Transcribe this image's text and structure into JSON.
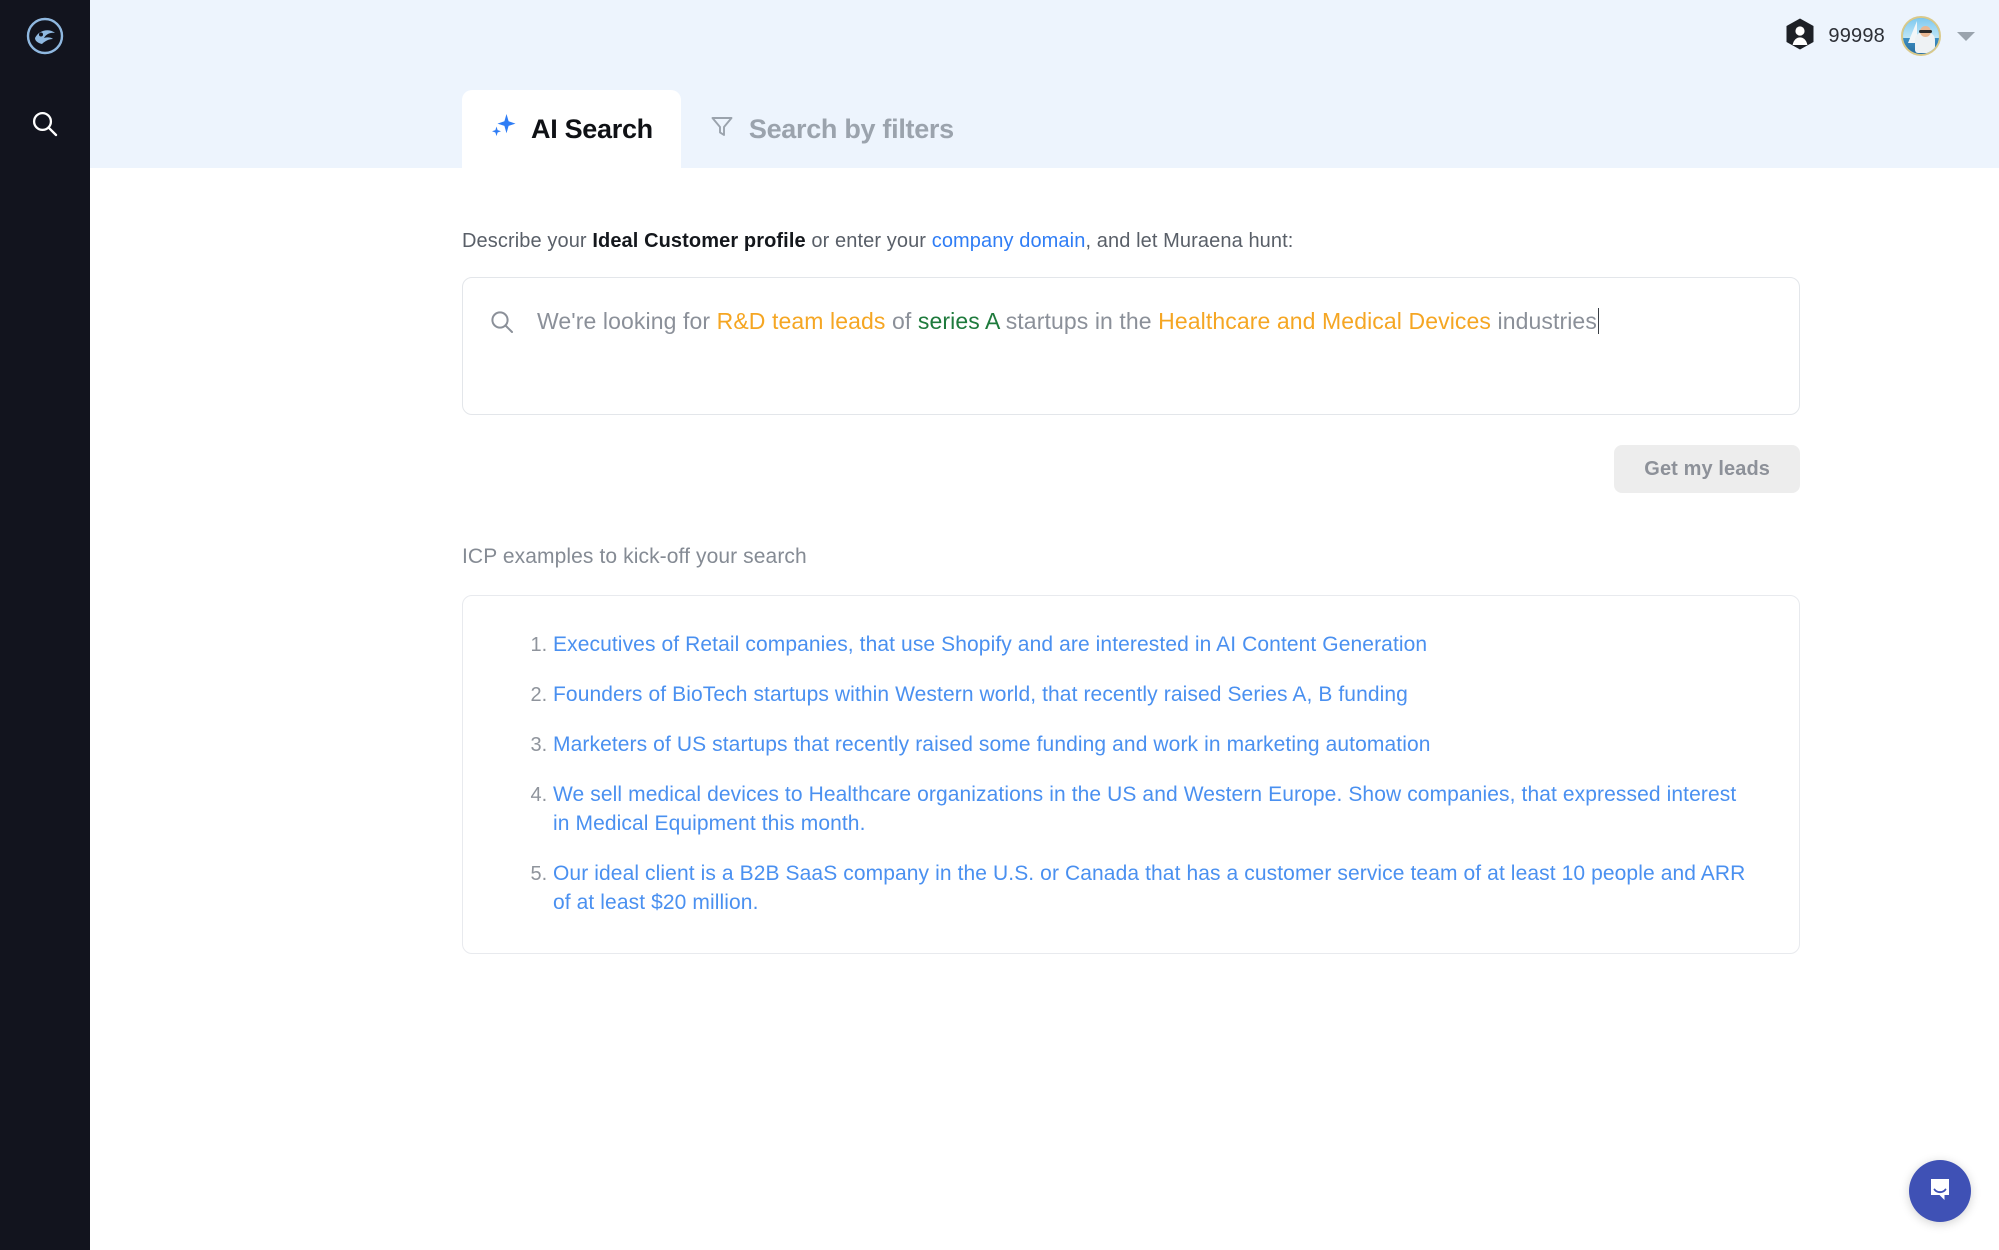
{
  "sidebar": {
    "logo_icon": "muraena-eel-logo-icon",
    "items": [
      {
        "icon": "search-icon",
        "label": "Search"
      }
    ]
  },
  "header": {
    "credits": {
      "icon": "hexagon-user-icon",
      "value": "99998"
    },
    "avatar": {
      "icon": "user-avatar-sailboat"
    },
    "dropdown_icon": "chevron-down-icon",
    "tabs": [
      {
        "label": "AI Search",
        "icon": "sparkles-icon",
        "active": true
      },
      {
        "label": "Search by filters",
        "icon": "filter-funnel-icon",
        "active": false
      }
    ]
  },
  "main": {
    "describe": {
      "part1": "Describe your ",
      "bold": "Ideal Customer profile",
      "part2": " or enter your ",
      "link": "company domain",
      "part3": ", and let Muraena hunt:"
    },
    "search": {
      "icon": "search-icon",
      "placeholder": "Describe your Ideal Customer profile",
      "segments": [
        {
          "text": "We're looking for ",
          "color": "plain"
        },
        {
          "text": "R&D team leads",
          "color": "orange"
        },
        {
          "text": " of ",
          "color": "plain"
        },
        {
          "text": "series A",
          "color": "green"
        },
        {
          "text": " startups in the ",
          "color": "plain"
        },
        {
          "text": "Healthcare and Medical Devices",
          "color": "orange"
        },
        {
          "text": " industries",
          "color": "plain"
        }
      ],
      "full_value": "We're looking for R&D team leads of series A startups in the Healthcare and Medical Devices industries"
    },
    "submit_label": "Get my leads",
    "icp_title": "ICP examples to kick-off your search",
    "examples": [
      "Executives of Retail companies, that use Shopify and are interested in AI Content Generation",
      "Founders of BioTech startups within Western world, that recently raised Series A, B funding",
      "Marketers of US startups that recently raised some funding and work in marketing automation",
      "We sell medical devices to Healthcare organizations in the US and Western Europe. Show companies, that expressed interest in Medical Equipment this month.",
      "Our ideal client is a B2B SaaS company in the U.S. or Canada that has a customer service team of at least 10 people and ARR of at least $20 million."
    ]
  },
  "chat_widget": {
    "icon": "intercom-chat-icon"
  },
  "colors": {
    "sidebar_bg": "#12141e",
    "header_bg": "#edf4fd",
    "accent_blue": "#2f7df5",
    "link_blue": "#4a90f0",
    "highlight_orange": "#f5a623",
    "highlight_green": "#1e7a3c",
    "chat_indigo": "#3f51b5"
  }
}
